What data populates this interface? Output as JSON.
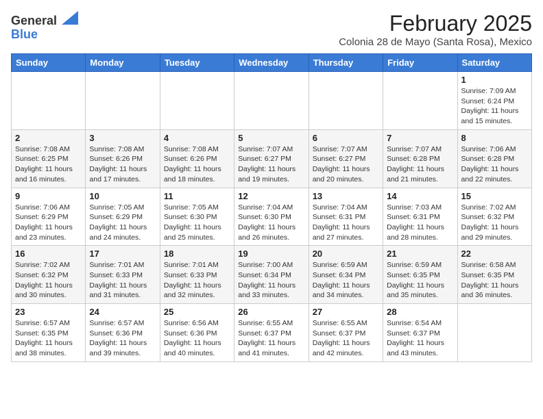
{
  "header": {
    "logo_general": "General",
    "logo_blue": "Blue",
    "main_title": "February 2025",
    "subtitle": "Colonia 28 de Mayo (Santa Rosa), Mexico"
  },
  "weekdays": [
    "Sunday",
    "Monday",
    "Tuesday",
    "Wednesday",
    "Thursday",
    "Friday",
    "Saturday"
  ],
  "weeks": [
    [
      {
        "day": null,
        "info": null
      },
      {
        "day": null,
        "info": null
      },
      {
        "day": null,
        "info": null
      },
      {
        "day": null,
        "info": null
      },
      {
        "day": null,
        "info": null
      },
      {
        "day": null,
        "info": null
      },
      {
        "day": "1",
        "info": "Sunrise: 7:09 AM\nSunset: 6:24 PM\nDaylight: 11 hours and 15 minutes."
      }
    ],
    [
      {
        "day": "2",
        "info": "Sunrise: 7:08 AM\nSunset: 6:25 PM\nDaylight: 11 hours and 16 minutes."
      },
      {
        "day": "3",
        "info": "Sunrise: 7:08 AM\nSunset: 6:26 PM\nDaylight: 11 hours and 17 minutes."
      },
      {
        "day": "4",
        "info": "Sunrise: 7:08 AM\nSunset: 6:26 PM\nDaylight: 11 hours and 18 minutes."
      },
      {
        "day": "5",
        "info": "Sunrise: 7:07 AM\nSunset: 6:27 PM\nDaylight: 11 hours and 19 minutes."
      },
      {
        "day": "6",
        "info": "Sunrise: 7:07 AM\nSunset: 6:27 PM\nDaylight: 11 hours and 20 minutes."
      },
      {
        "day": "7",
        "info": "Sunrise: 7:07 AM\nSunset: 6:28 PM\nDaylight: 11 hours and 21 minutes."
      },
      {
        "day": "8",
        "info": "Sunrise: 7:06 AM\nSunset: 6:28 PM\nDaylight: 11 hours and 22 minutes."
      }
    ],
    [
      {
        "day": "9",
        "info": "Sunrise: 7:06 AM\nSunset: 6:29 PM\nDaylight: 11 hours and 23 minutes."
      },
      {
        "day": "10",
        "info": "Sunrise: 7:05 AM\nSunset: 6:29 PM\nDaylight: 11 hours and 24 minutes."
      },
      {
        "day": "11",
        "info": "Sunrise: 7:05 AM\nSunset: 6:30 PM\nDaylight: 11 hours and 25 minutes."
      },
      {
        "day": "12",
        "info": "Sunrise: 7:04 AM\nSunset: 6:30 PM\nDaylight: 11 hours and 26 minutes."
      },
      {
        "day": "13",
        "info": "Sunrise: 7:04 AM\nSunset: 6:31 PM\nDaylight: 11 hours and 27 minutes."
      },
      {
        "day": "14",
        "info": "Sunrise: 7:03 AM\nSunset: 6:31 PM\nDaylight: 11 hours and 28 minutes."
      },
      {
        "day": "15",
        "info": "Sunrise: 7:02 AM\nSunset: 6:32 PM\nDaylight: 11 hours and 29 minutes."
      }
    ],
    [
      {
        "day": "16",
        "info": "Sunrise: 7:02 AM\nSunset: 6:32 PM\nDaylight: 11 hours and 30 minutes."
      },
      {
        "day": "17",
        "info": "Sunrise: 7:01 AM\nSunset: 6:33 PM\nDaylight: 11 hours and 31 minutes."
      },
      {
        "day": "18",
        "info": "Sunrise: 7:01 AM\nSunset: 6:33 PM\nDaylight: 11 hours and 32 minutes."
      },
      {
        "day": "19",
        "info": "Sunrise: 7:00 AM\nSunset: 6:34 PM\nDaylight: 11 hours and 33 minutes."
      },
      {
        "day": "20",
        "info": "Sunrise: 6:59 AM\nSunset: 6:34 PM\nDaylight: 11 hours and 34 minutes."
      },
      {
        "day": "21",
        "info": "Sunrise: 6:59 AM\nSunset: 6:35 PM\nDaylight: 11 hours and 35 minutes."
      },
      {
        "day": "22",
        "info": "Sunrise: 6:58 AM\nSunset: 6:35 PM\nDaylight: 11 hours and 36 minutes."
      }
    ],
    [
      {
        "day": "23",
        "info": "Sunrise: 6:57 AM\nSunset: 6:35 PM\nDaylight: 11 hours and 38 minutes."
      },
      {
        "day": "24",
        "info": "Sunrise: 6:57 AM\nSunset: 6:36 PM\nDaylight: 11 hours and 39 minutes."
      },
      {
        "day": "25",
        "info": "Sunrise: 6:56 AM\nSunset: 6:36 PM\nDaylight: 11 hours and 40 minutes."
      },
      {
        "day": "26",
        "info": "Sunrise: 6:55 AM\nSunset: 6:37 PM\nDaylight: 11 hours and 41 minutes."
      },
      {
        "day": "27",
        "info": "Sunrise: 6:55 AM\nSunset: 6:37 PM\nDaylight: 11 hours and 42 minutes."
      },
      {
        "day": "28",
        "info": "Sunrise: 6:54 AM\nSunset: 6:37 PM\nDaylight: 11 hours and 43 minutes."
      },
      {
        "day": null,
        "info": null
      }
    ]
  ]
}
